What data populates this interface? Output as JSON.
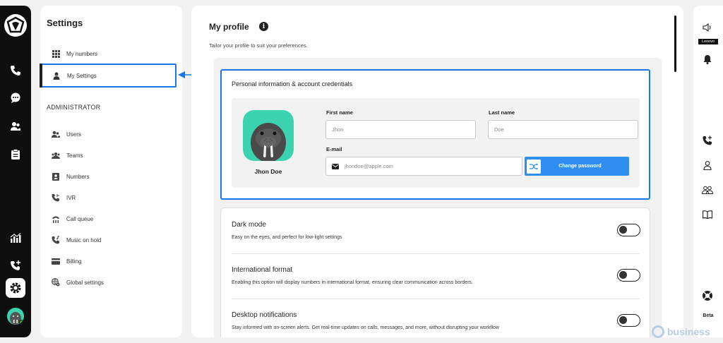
{
  "settings": {
    "title": "Settings",
    "items": [
      {
        "label": "My numbers",
        "icon": "grid-icon"
      },
      {
        "label": "My Settings",
        "icon": "user-icon",
        "active": true
      }
    ],
    "admin_label": "ADMINISTRATOR",
    "admin_items": [
      {
        "label": "Users",
        "icon": "users-icon"
      },
      {
        "label": "Teams",
        "icon": "teams-icon"
      },
      {
        "label": "Numbers",
        "icon": "numbers-icon"
      },
      {
        "label": "IVR",
        "icon": "ivr-icon"
      },
      {
        "label": "Call queue",
        "icon": "call-queue-icon"
      },
      {
        "label": "Music on hold",
        "icon": "music-on-hold-icon"
      },
      {
        "label": "Billing",
        "icon": "billing-icon"
      },
      {
        "label": "Global settings",
        "icon": "globe-gear-icon"
      }
    ]
  },
  "profile": {
    "title": "My profile",
    "subtitle": "Tailor your profile to suit your preferences.",
    "personal_card_title": "Personal information & account credentials",
    "user_name": "Jhon Doe",
    "first_name_label": "First name",
    "first_name_value": "Jhon",
    "last_name_label": "Last name",
    "last_name_value": "Doe",
    "email_label": "E-mail",
    "email_value": "jhondoe@apple.com",
    "change_password_label": "Change password"
  },
  "preferences": [
    {
      "title": "Dark mode",
      "desc": "Easy on the eyes, and perfect for low-light settings",
      "enabled": false
    },
    {
      "title": "International format",
      "desc": "Enabling this option will display numbers in international format, ensuring clear communication across borders.",
      "enabled": false
    },
    {
      "title": "Desktop notifications",
      "desc": "Stay informed with on-screen alerts. Get real-time updates on calls, messages, and more, without disrupting your workflow",
      "enabled": false
    }
  ],
  "right_rail": {
    "lenovo_label": "Lenovo",
    "beta_label": "Beta"
  },
  "watermark": "business",
  "colors": {
    "accent": "#1976e8",
    "button": "#2e8ff0",
    "avatar_bg": "#3bd3b0",
    "rail_bg": "#0f0f0f"
  }
}
